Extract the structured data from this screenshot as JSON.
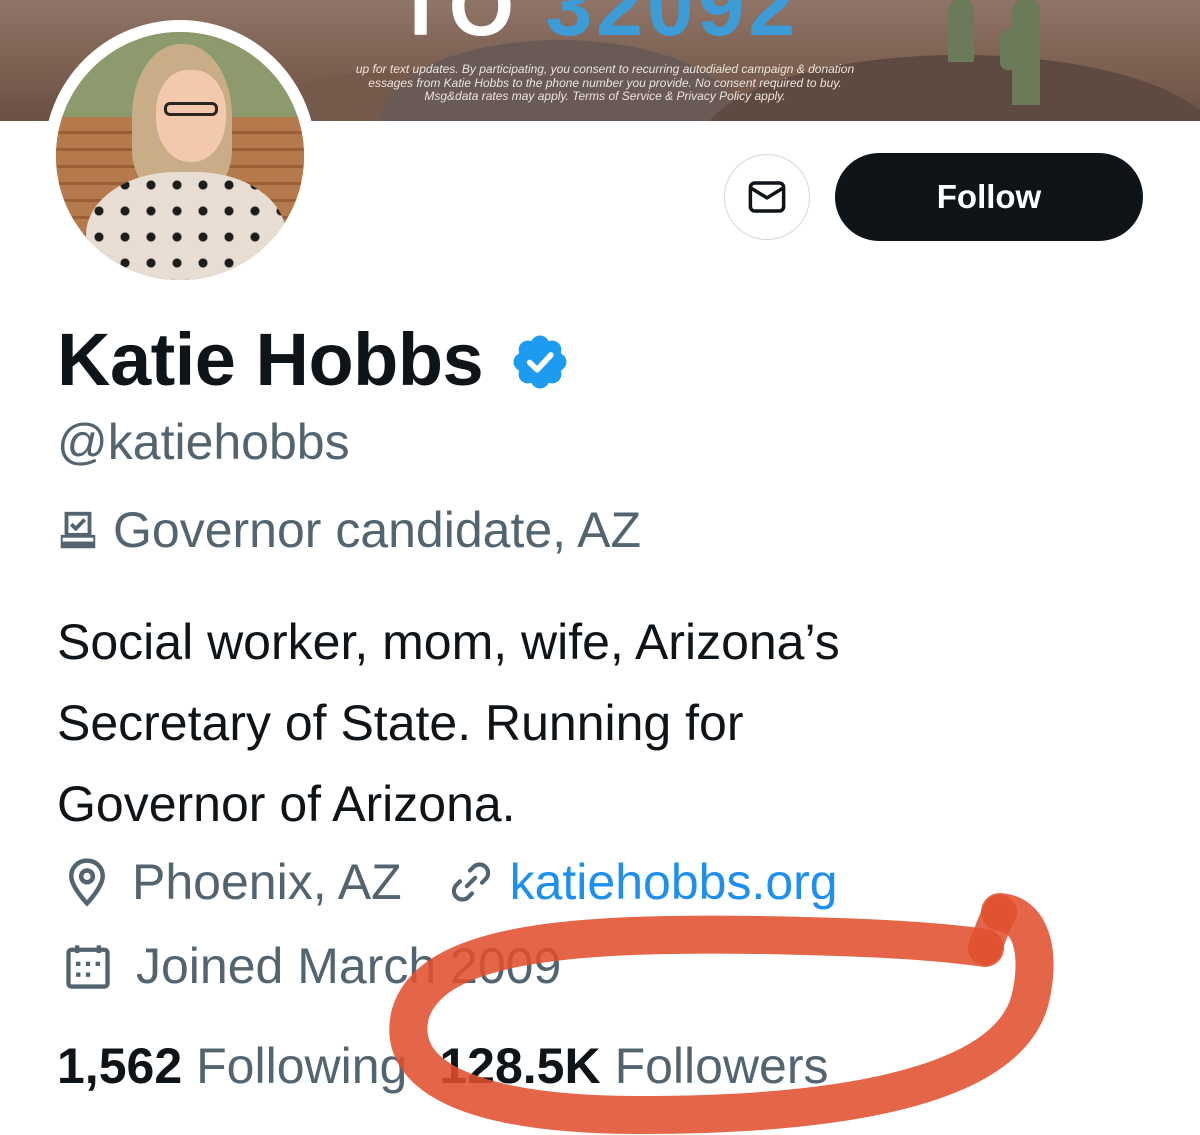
{
  "banner": {
    "number_partial": "TO",
    "code_partial": "32092",
    "disclaimer_lines": [
      "up for text updates. By participating, you consent to recurring autodialed campaign & donation",
      "essages from Katie Hobbs to the phone number you provide. No consent required to buy.",
      "Msg&data rates may apply. Terms of Service & Privacy Policy apply."
    ]
  },
  "actions": {
    "message_icon": "envelope-icon",
    "follow_label": "Follow"
  },
  "profile": {
    "name": "Katie Hobbs",
    "verified_icon": "verified-badge-icon",
    "handle": "@katiehobbs",
    "category_icon": "ballot-box-icon",
    "category": "Governor candidate, AZ",
    "bio_lines": [
      "Social worker, mom, wife, Arizona’s",
      "Secretary of State. Running for",
      "Governor of Arizona."
    ],
    "location_icon": "location-pin-icon",
    "location": "Phoenix, AZ",
    "link_icon": "link-icon",
    "website": "katiehobbs.org",
    "joined_icon": "calendar-icon",
    "joined": "Joined March 2009"
  },
  "stats": {
    "following_count": "1,562",
    "following_label": "Following",
    "followers_count": "128.5K",
    "followers_label": "Followers"
  },
  "colors": {
    "text_primary": "#0f1419",
    "text_secondary": "#536471",
    "link": "#1d8ff0",
    "verified": "#1d9bf0",
    "annotation_marker": "#e0502e"
  }
}
